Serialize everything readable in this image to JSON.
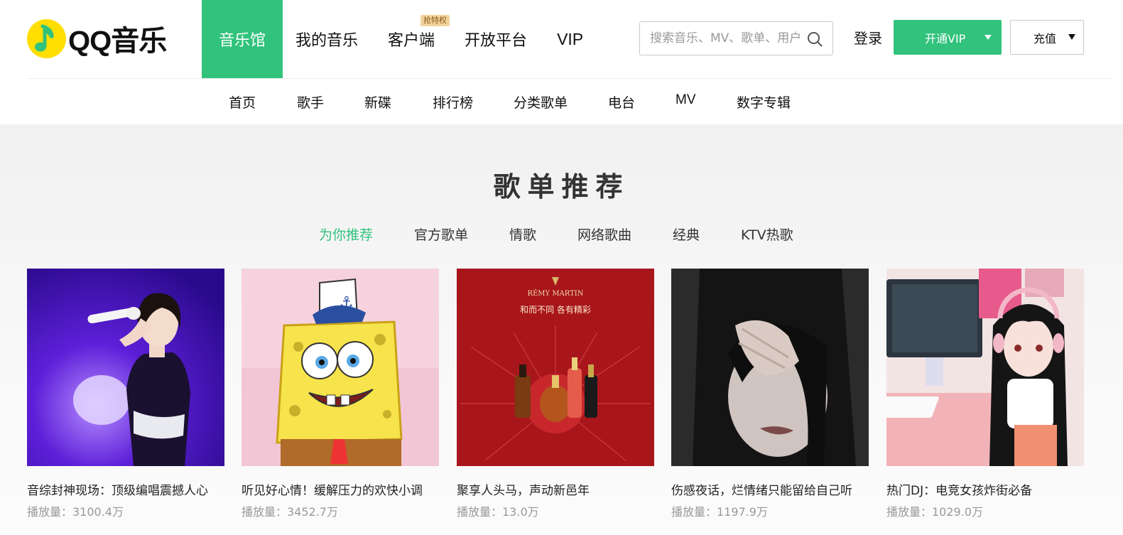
{
  "brand": {
    "name": "QQ音乐",
    "accent": "#31c27c"
  },
  "main_nav": [
    {
      "label": "音乐馆",
      "active": true
    },
    {
      "label": "我的音乐"
    },
    {
      "label": "客户端",
      "badge": "抢特权"
    },
    {
      "label": "开放平台"
    },
    {
      "label": "VIP"
    }
  ],
  "search": {
    "placeholder": "搜索音乐、MV、歌单、用户",
    "value": ""
  },
  "header_actions": {
    "login": "登录",
    "vip": "开通VIP",
    "recharge": "充值"
  },
  "sub_nav": [
    "首页",
    "歌手",
    "新碟",
    "排行榜",
    "分类歌单",
    "电台",
    "MV",
    "数字专辑"
  ],
  "section": {
    "title": "歌单推荐",
    "tabs": [
      {
        "label": "为你推荐",
        "active": true
      },
      {
        "label": "官方歌单"
      },
      {
        "label": "情歌"
      },
      {
        "label": "网络歌曲"
      },
      {
        "label": "经典"
      },
      {
        "label": "KTV热歌"
      }
    ]
  },
  "playlists": [
    {
      "title": "音综封神现场：顶级编唱震撼人心",
      "plays": "播放量：3100.4万"
    },
    {
      "title": "听见好心情！缓解压力的欢快小调",
      "plays": "播放量：3452.7万"
    },
    {
      "title": "聚享人头马，声动新邑年",
      "plays": "播放量：13.0万",
      "cover_text": {
        "brand": "RÉMY MARTIN",
        "slogan": "和而不同 各有精彩"
      }
    },
    {
      "title": "伤感夜话，烂情绪只能留给自己听",
      "plays": "播放量：1197.9万"
    },
    {
      "title": "热门DJ：电竞女孩炸街必备",
      "plays": "播放量：1029.0万"
    }
  ]
}
